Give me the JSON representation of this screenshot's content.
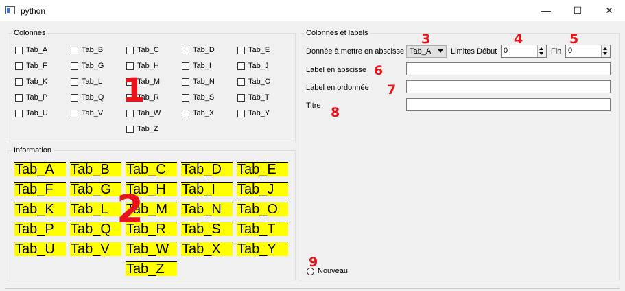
{
  "window": {
    "title": "python",
    "minimize": "—",
    "maximize": "☐",
    "close": "✕"
  },
  "colonnes": {
    "title": "Colonnes",
    "rows": [
      [
        "Tab_A",
        "Tab_B",
        "Tab_C",
        "Tab_D",
        "Tab_E"
      ],
      [
        "Tab_F",
        "Tab_G",
        "Tab_H",
        "Tab_I",
        "Tab_J"
      ],
      [
        "Tab_K",
        "Tab_L",
        "Tab_M",
        "Tab_N",
        "Tab_O"
      ],
      [
        "Tab_P",
        "Tab_Q",
        "Tab_R",
        "Tab_S",
        "Tab_T"
      ],
      [
        "Tab_U",
        "Tab_V",
        "Tab_W",
        "Tab_X",
        "Tab_Y"
      ],
      [
        "",
        "",
        "Tab_Z",
        "",
        ""
      ]
    ]
  },
  "information": {
    "title": "Information",
    "rows": [
      [
        "Tab_A",
        "Tab_B",
        "Tab_C",
        "Tab_D",
        "Tab_E"
      ],
      [
        "Tab_F",
        "Tab_G",
        "Tab_H",
        "Tab_I",
        "Tab_J"
      ],
      [
        "Tab_K",
        "Tab_L",
        "Tab_M",
        "Tab_N",
        "Tab_O"
      ],
      [
        "Tab_P",
        "Tab_Q",
        "Tab_R",
        "Tab_S",
        "Tab_T"
      ],
      [
        "Tab_U",
        "Tab_V",
        "Tab_W",
        "Tab_X",
        "Tab_Y"
      ],
      [
        "",
        "",
        "Tab_Z",
        "",
        ""
      ]
    ],
    "highlight_color": "#ffff00"
  },
  "labels_group": {
    "title": "Colonnes et labels",
    "abscisse_label": "Donnée à mettre en abscisse",
    "abscisse_value": "Tab_A",
    "limites_label": "Limites",
    "debut_label": "Début",
    "debut_value": "0",
    "fin_label": "Fin",
    "fin_value": "0",
    "xlabel_label": "Label en abscisse",
    "xlabel_value": "",
    "ylabel_label": "Label en ordonnée",
    "ylabel_value": "",
    "titre_label": "Titre",
    "titre_value": "",
    "nouveau_label": "Nouveau"
  },
  "annotations": {
    "color": "#e8141c",
    "n1": "1",
    "n2": "2",
    "n3": "3",
    "n4": "4",
    "n5": "5",
    "n6": "6",
    "n7": "7",
    "n8": "8",
    "n9": "9"
  }
}
